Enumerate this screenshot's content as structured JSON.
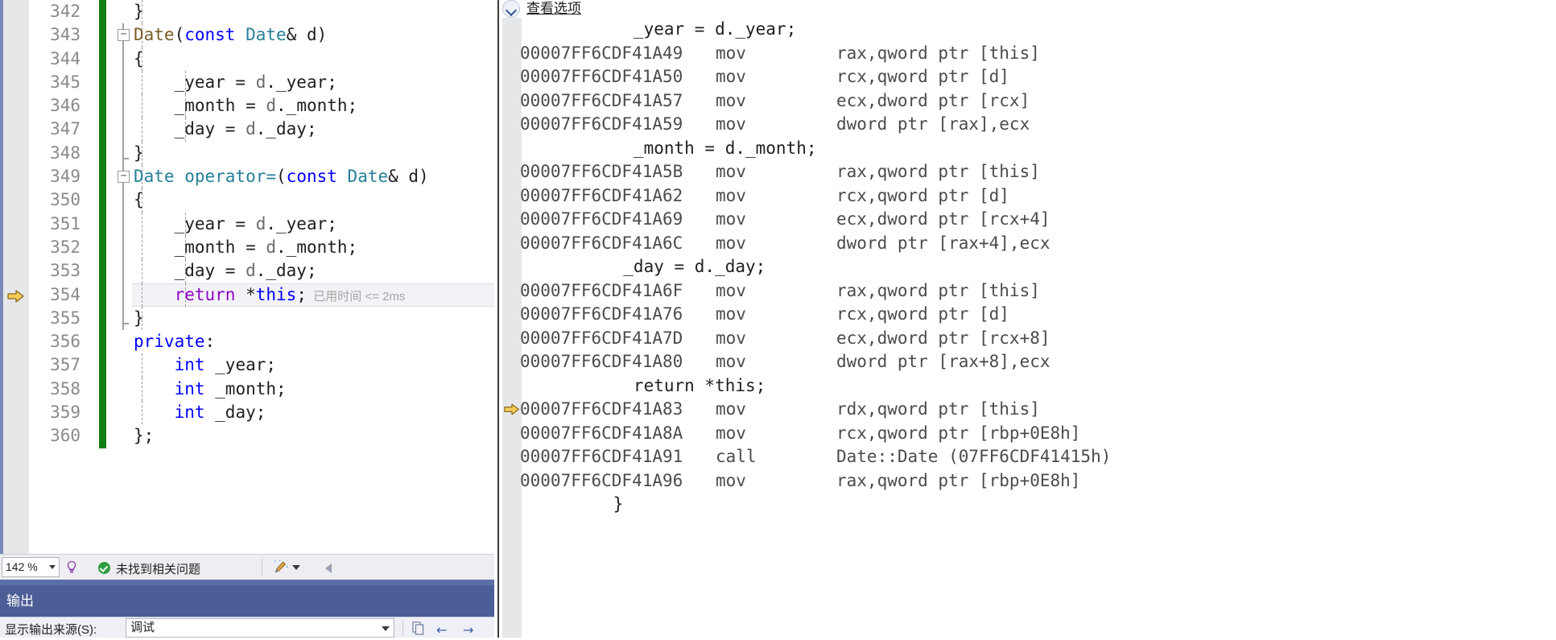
{
  "editor": {
    "lines": [
      {
        "num": "342",
        "indent": 0,
        "outline": "",
        "text": "}",
        "tokens": [
          {
            "t": "}",
            "c": "punc"
          }
        ],
        "guides": [
          1
        ],
        "current": false
      },
      {
        "num": "343",
        "indent": 0,
        "outline": "collapse",
        "text": "Date(const Date& d)",
        "tokens": [
          {
            "t": "Date",
            "c": "fn"
          },
          {
            "t": "(",
            "c": "punc"
          },
          {
            "t": "const",
            "c": "kw"
          },
          {
            "t": " ",
            "c": "punc"
          },
          {
            "t": "Date",
            "c": "cls"
          },
          {
            "t": "& d)",
            "c": "punc"
          }
        ],
        "guides": [
          1
        ],
        "current": false
      },
      {
        "num": "344",
        "indent": 0,
        "outline": "rail",
        "text": "{",
        "tokens": [
          {
            "t": "{",
            "c": "punc"
          }
        ],
        "guides": [
          1
        ],
        "current": false
      },
      {
        "num": "345",
        "indent": 0,
        "outline": "rail",
        "text": "    _year = d._year;",
        "tokens": [
          {
            "t": "    _year = ",
            "c": "id"
          },
          {
            "t": "d",
            "c": "obj"
          },
          {
            "t": "._year;",
            "c": "id"
          }
        ],
        "guides": [
          1,
          2
        ],
        "current": false
      },
      {
        "num": "346",
        "indent": 0,
        "outline": "rail",
        "text": "    _month = d._month;",
        "tokens": [
          {
            "t": "    _month = ",
            "c": "id"
          },
          {
            "t": "d",
            "c": "obj"
          },
          {
            "t": "._month;",
            "c": "id"
          }
        ],
        "guides": [
          1,
          2
        ],
        "current": false
      },
      {
        "num": "347",
        "indent": 0,
        "outline": "rail",
        "text": "    _day = d._day;",
        "tokens": [
          {
            "t": "    _day = ",
            "c": "id"
          },
          {
            "t": "d",
            "c": "obj"
          },
          {
            "t": "._day;",
            "c": "id"
          }
        ],
        "guides": [
          1,
          2
        ],
        "current": false
      },
      {
        "num": "348",
        "indent": 0,
        "outline": "railend",
        "text": "}",
        "tokens": [
          {
            "t": "}",
            "c": "punc"
          }
        ],
        "guides": [
          1
        ],
        "current": false
      },
      {
        "num": "349",
        "indent": 0,
        "outline": "collapse",
        "text": "Date operator=(const Date& d)",
        "tokens": [
          {
            "t": "Date operator=",
            "c": "cls"
          },
          {
            "t": "(",
            "c": "punc"
          },
          {
            "t": "const",
            "c": "kw"
          },
          {
            "t": " ",
            "c": "punc"
          },
          {
            "t": "Date",
            "c": "cls"
          },
          {
            "t": "& d)",
            "c": "punc"
          }
        ],
        "guides": [
          1
        ],
        "current": false
      },
      {
        "num": "350",
        "indent": 0,
        "outline": "rail",
        "text": "{",
        "tokens": [
          {
            "t": "{",
            "c": "punc"
          }
        ],
        "guides": [
          1
        ],
        "current": false
      },
      {
        "num": "351",
        "indent": 0,
        "outline": "rail",
        "text": "    _year = d._year;",
        "tokens": [
          {
            "t": "    _year = ",
            "c": "id"
          },
          {
            "t": "d",
            "c": "obj"
          },
          {
            "t": "._year;",
            "c": "id"
          }
        ],
        "guides": [
          1,
          2
        ],
        "current": false
      },
      {
        "num": "352",
        "indent": 0,
        "outline": "rail",
        "text": "    _month = d._month;",
        "tokens": [
          {
            "t": "    _month = ",
            "c": "id"
          },
          {
            "t": "d",
            "c": "obj"
          },
          {
            "t": "._month;",
            "c": "id"
          }
        ],
        "guides": [
          1,
          2
        ],
        "current": false
      },
      {
        "num": "353",
        "indent": 0,
        "outline": "rail",
        "text": "    _day = d._day;",
        "tokens": [
          {
            "t": "    _day = ",
            "c": "id"
          },
          {
            "t": "d",
            "c": "obj"
          },
          {
            "t": "._day;",
            "c": "id"
          }
        ],
        "guides": [
          1,
          2
        ],
        "current": false
      },
      {
        "num": "354",
        "indent": 0,
        "outline": "rail",
        "text": "    return *this;",
        "tokens": [
          {
            "t": "    ",
            "c": "id"
          },
          {
            "t": "return",
            "c": "ctrl"
          },
          {
            "t": " *",
            "c": "punc"
          },
          {
            "t": "this",
            "c": "kw"
          },
          {
            "t": ";",
            "c": "punc"
          }
        ],
        "guides": [
          1,
          2
        ],
        "current": true,
        "elapsed": "已用时间 <= 2ms"
      },
      {
        "num": "355",
        "indent": 0,
        "outline": "railend",
        "text": "}",
        "tokens": [
          {
            "t": "}",
            "c": "punc"
          }
        ],
        "guides": [
          1
        ],
        "current": false
      },
      {
        "num": "356",
        "indent": 0,
        "outline": "none",
        "text": "private:",
        "tokens": [
          {
            "t": "private",
            "c": "kw"
          },
          {
            "t": ":",
            "c": "punc"
          }
        ],
        "guides": [],
        "current": false,
        "noindent": true
      },
      {
        "num": "357",
        "indent": 0,
        "outline": "none",
        "text": "    int _year;",
        "tokens": [
          {
            "t": "    ",
            "c": "id"
          },
          {
            "t": "int",
            "c": "kw"
          },
          {
            "t": " _year;",
            "c": "id"
          }
        ],
        "guides": [
          1
        ],
        "current": false
      },
      {
        "num": "358",
        "indent": 0,
        "outline": "none",
        "text": "    int _month;",
        "tokens": [
          {
            "t": "    ",
            "c": "id"
          },
          {
            "t": "int",
            "c": "kw"
          },
          {
            "t": " _month;",
            "c": "id"
          }
        ],
        "guides": [
          1
        ],
        "current": false
      },
      {
        "num": "359",
        "indent": 0,
        "outline": "none",
        "text": "    int _day;",
        "tokens": [
          {
            "t": "    ",
            "c": "id"
          },
          {
            "t": "int",
            "c": "kw"
          },
          {
            "t": " _day;",
            "c": "id"
          }
        ],
        "guides": [
          1
        ],
        "current": false
      },
      {
        "num": "360",
        "indent": 0,
        "outline": "none",
        "text": "};",
        "tokens": [
          {
            "t": "};",
            "c": "punc"
          }
        ],
        "guides": [],
        "current": false,
        "noindent": true
      }
    ]
  },
  "editor_status": {
    "zoom_level": "142 %",
    "bulb_icon": "lightbulb-icon",
    "error_status_icon": "checkmark-circle-icon",
    "error_status_text": "未找到相关问题",
    "broom_icon": "code-cleanup-broom-icon",
    "prev_icon": "chevron-left-icon"
  },
  "output_panel": {
    "title": "输出",
    "source_label": "显示输出来源(S):",
    "source_value": "调试",
    "toolbar_icons": [
      "copy-icon",
      "back-arrow-icon",
      "forward-arrow-icon"
    ]
  },
  "disassembly": {
    "view_options_link": "查看选项",
    "view_options_icon": "chevron-down-circle-icon",
    "rows": [
      {
        "kind": "src",
        "src": "   _year = d._year;"
      },
      {
        "kind": "asm",
        "addr": "00007FF6CDF41A49",
        "mn": "mov",
        "op": "rax,qword ptr [this]"
      },
      {
        "kind": "asm",
        "addr": "00007FF6CDF41A50",
        "mn": "mov",
        "op": "rcx,qword ptr [d]"
      },
      {
        "kind": "asm",
        "addr": "00007FF6CDF41A57",
        "mn": "mov",
        "op": "ecx,dword ptr [rcx]"
      },
      {
        "kind": "asm",
        "addr": "00007FF6CDF41A59",
        "mn": "mov",
        "op": "dword ptr [rax],ecx"
      },
      {
        "kind": "src",
        "src": "   _month = d._month;"
      },
      {
        "kind": "asm",
        "addr": "00007FF6CDF41A5B",
        "mn": "mov",
        "op": "rax,qword ptr [this]"
      },
      {
        "kind": "asm",
        "addr": "00007FF6CDF41A62",
        "mn": "mov",
        "op": "rcx,qword ptr [d]"
      },
      {
        "kind": "asm",
        "addr": "00007FF6CDF41A69",
        "mn": "mov",
        "op": "ecx,dword ptr [rcx+4]"
      },
      {
        "kind": "asm",
        "addr": "00007FF6CDF41A6C",
        "mn": "mov",
        "op": "dword ptr [rax+4],ecx"
      },
      {
        "kind": "src",
        "src": "  _day = d._day;"
      },
      {
        "kind": "asm",
        "addr": "00007FF6CDF41A6F",
        "mn": "mov",
        "op": "rax,qword ptr [this]"
      },
      {
        "kind": "asm",
        "addr": "00007FF6CDF41A76",
        "mn": "mov",
        "op": "rcx,qword ptr [d]"
      },
      {
        "kind": "asm",
        "addr": "00007FF6CDF41A7D",
        "mn": "mov",
        "op": "ecx,dword ptr [rcx+8]"
      },
      {
        "kind": "asm",
        "addr": "00007FF6CDF41A80",
        "mn": "mov",
        "op": "dword ptr [rax+8],ecx"
      },
      {
        "kind": "src",
        "src": "   return *this;"
      },
      {
        "kind": "asm",
        "addr": "00007FF6CDF41A83",
        "mn": "mov",
        "op": "rdx,qword ptr [this]",
        "current": true
      },
      {
        "kind": "asm",
        "addr": "00007FF6CDF41A8A",
        "mn": "mov",
        "op": "rcx,qword ptr [rbp+0E8h]"
      },
      {
        "kind": "asm",
        "addr": "00007FF6CDF41A91",
        "mn": "call",
        "op": "Date::Date (07FF6CDF41415h)"
      },
      {
        "kind": "asm",
        "addr": "00007FF6CDF41A96",
        "mn": "mov",
        "op": "rax,qword ptr [rbp+0E8h]"
      },
      {
        "kind": "src",
        "src": " }"
      }
    ]
  },
  "colors": {
    "keyword": "#0000ff",
    "class_type": "#267f99",
    "function": "#795e26",
    "control_flow": "#8f08c4",
    "change_bar_saved": "#108010",
    "exec_arrow": "#f5c542",
    "output_panel_bg": "#4c5e96",
    "status_ok": "#2e9e3f"
  }
}
